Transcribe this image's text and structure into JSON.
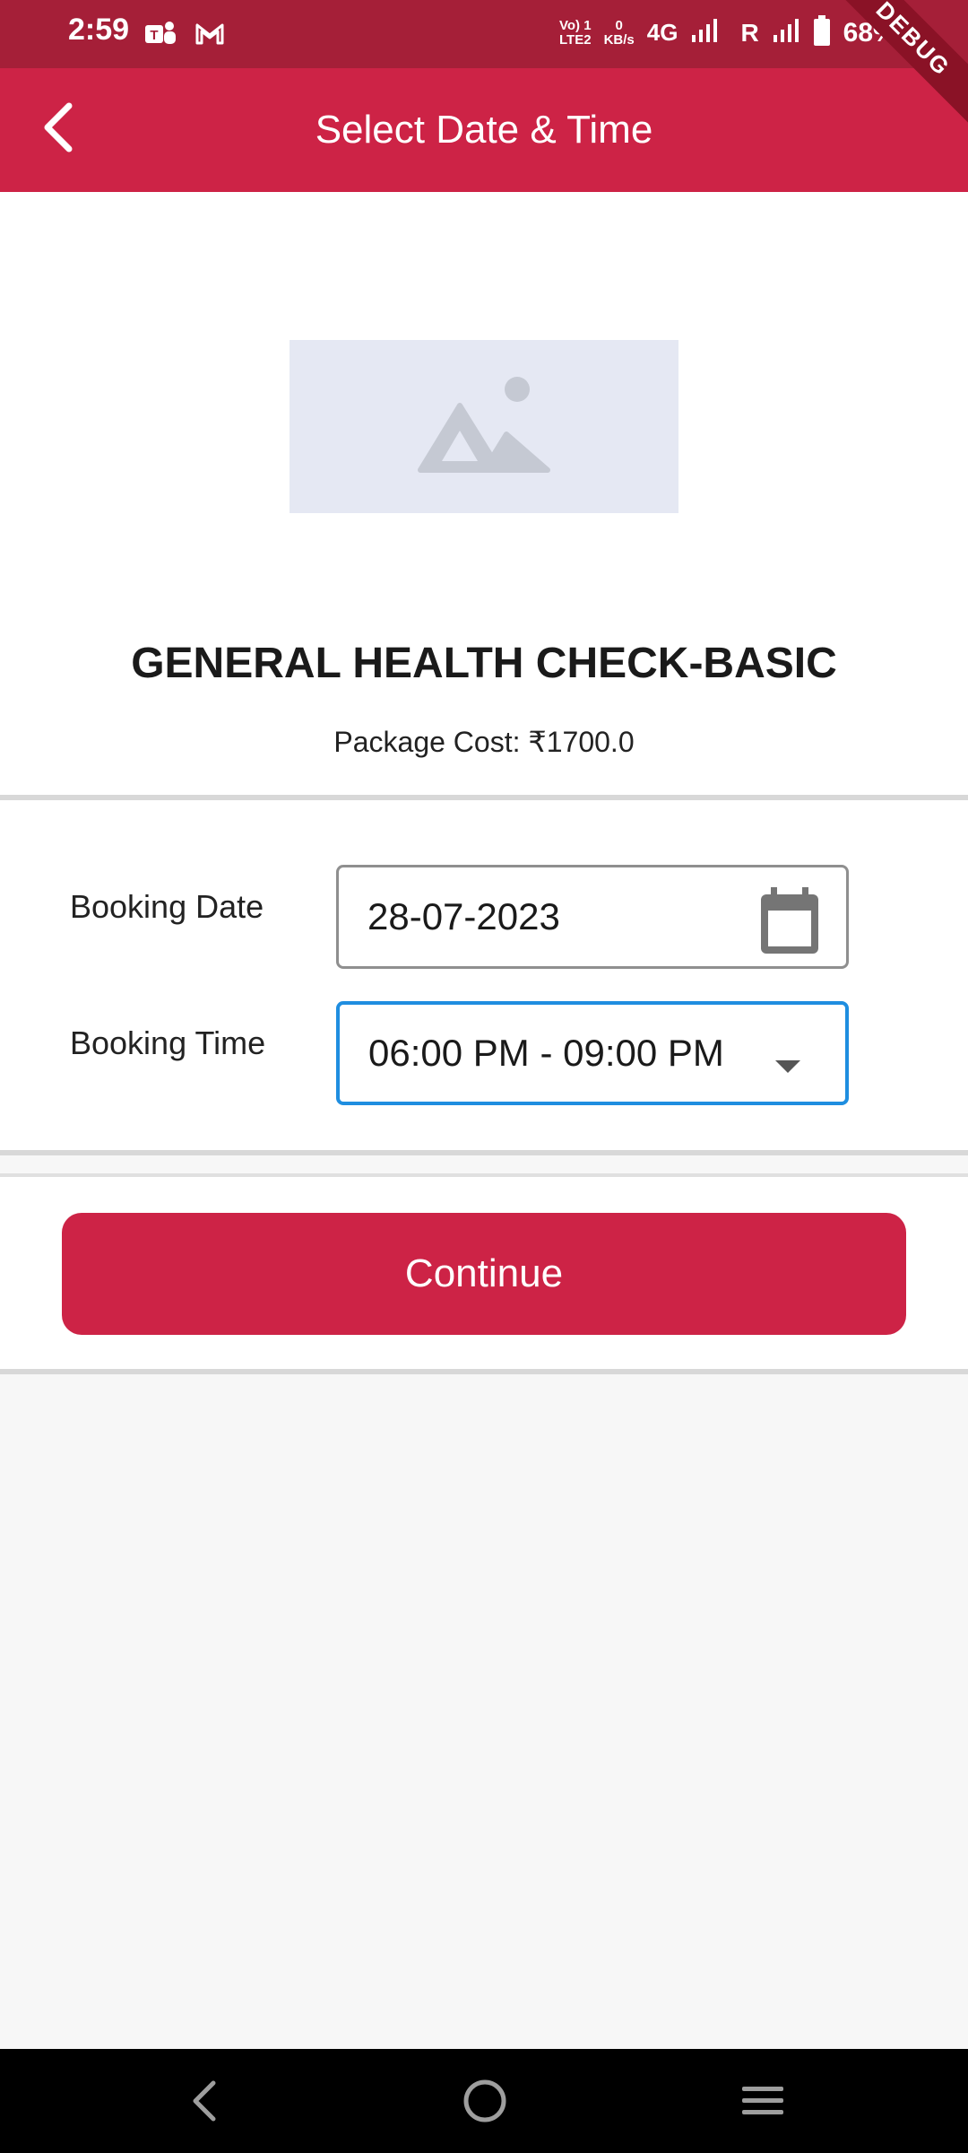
{
  "status_bar": {
    "time": "2:59",
    "volte_line1": "Vo) 1",
    "volte_line2": "LTE2",
    "speed_line1": "0",
    "speed_line2": "KB/s",
    "network": "4G",
    "roaming": "R",
    "battery": "68%"
  },
  "debug_banner": "DEBUG",
  "app_bar": {
    "title": "Select Date & Time"
  },
  "package": {
    "name": "GENERAL HEALTH CHECK-BASIC",
    "cost": "Package Cost: ₹1700.0"
  },
  "form": {
    "date_label": "Booking Date",
    "date_value": "28-07-2023",
    "time_label": "Booking Time",
    "time_value": "06:00 PM - 09:00 PM"
  },
  "continue_label": "Continue",
  "colors": {
    "primary": "#cd2346",
    "status_bar": "#a51f38",
    "focus_border": "#1f8ee0"
  },
  "icons": [
    "teams-icon",
    "gmail-icon",
    "signal-icon",
    "battery-icon",
    "back-arrow-icon",
    "image-placeholder-icon",
    "calendar-icon",
    "dropdown-caret-icon",
    "nav-back-icon",
    "nav-home-icon",
    "nav-recents-icon"
  ]
}
